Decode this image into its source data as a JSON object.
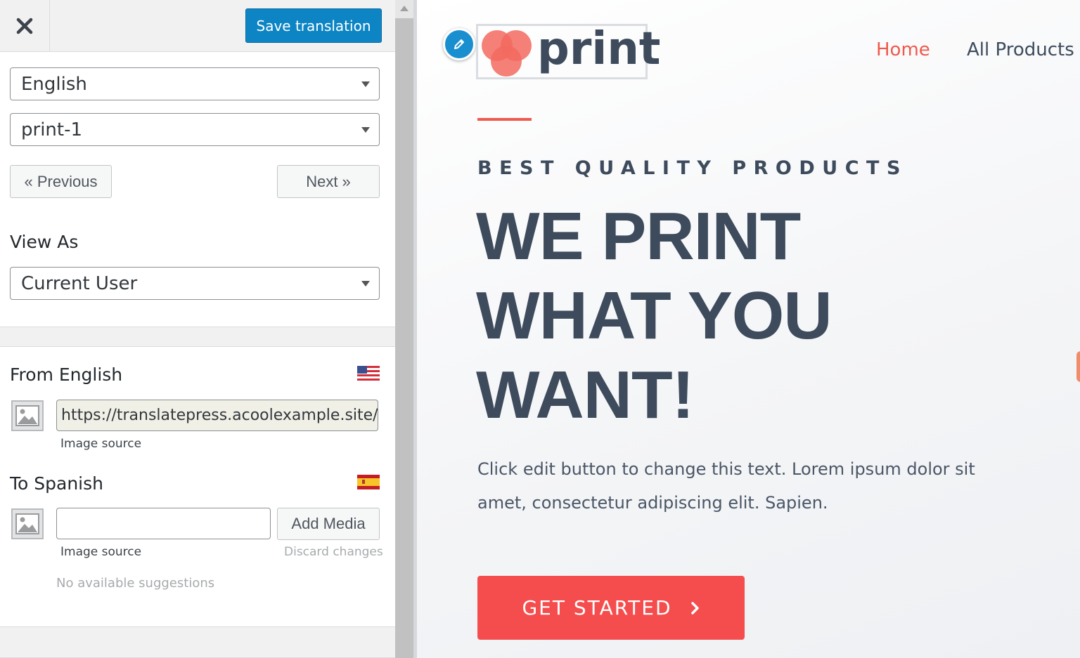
{
  "editor": {
    "save_label": "Save translation",
    "language_select": "English",
    "string_select": "print-1",
    "previous_label": "« Previous",
    "next_label": "Next »",
    "view_as_label": "View As",
    "view_as_select": "Current User",
    "from_label": "From English",
    "from_url": "https://translatepress.acoolexample.site/w",
    "from_hint": "Image source",
    "to_label": "To Spanish",
    "to_value": "",
    "add_media_label": "Add Media",
    "to_hint": "Image source",
    "discard_label": "Discard changes",
    "suggestions_text": "No available suggestions"
  },
  "site": {
    "logo_text": "print",
    "nav": [
      {
        "label": "Home",
        "active": true
      },
      {
        "label": "All Products",
        "active": false
      }
    ],
    "eyebrow": "BEST QUALITY PRODUCTS",
    "headline_lines": [
      "WE PRINT",
      "WHAT YOU",
      "WANT!"
    ],
    "body_text": "Click edit button to change this text. Lorem ipsum dolor sit amet, consectetur adipiscing elit. Sapien.",
    "cta_label": "GET STARTED"
  },
  "colors": {
    "accent": "#ef5a4c",
    "cta": "#f54d4d",
    "heading": "#3d4b5c",
    "wp_blue": "#0d85c4"
  },
  "icons": [
    "close-icon",
    "caret-down-icon",
    "us-flag-icon",
    "spain-flag-icon",
    "image-placeholder-icon",
    "pencil-icon",
    "chevron-right-icon"
  ]
}
